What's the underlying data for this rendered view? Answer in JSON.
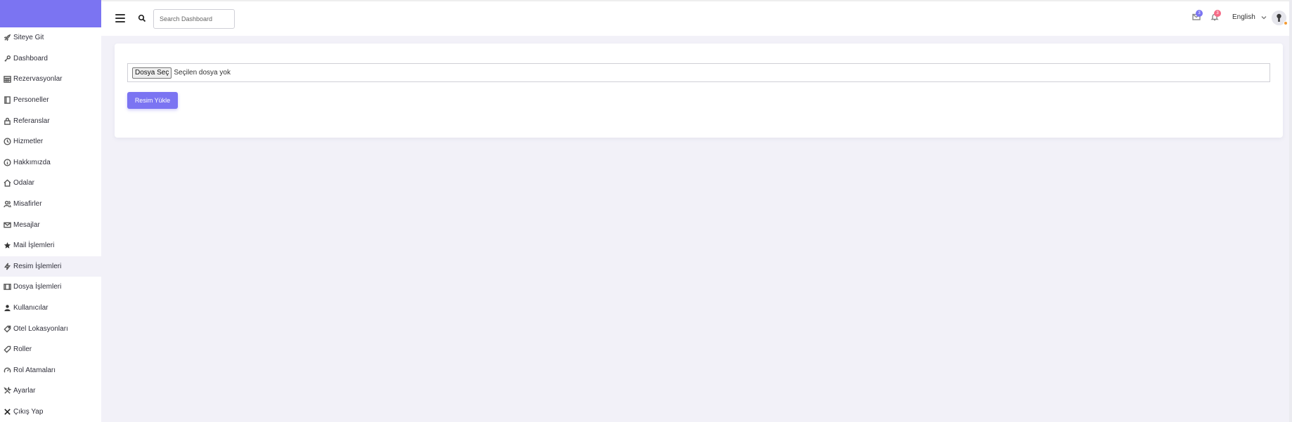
{
  "header": {
    "search_placeholder": "Search Dashboard",
    "mail_badge": "3",
    "notification_badge": "3",
    "language": "English"
  },
  "sidebar": {
    "items": [
      {
        "label": "Siteye Git",
        "icon": "rocket-icon"
      },
      {
        "label": "Dashboard",
        "icon": "key-icon"
      },
      {
        "label": "Rezervasyonlar",
        "icon": "calendar-icon"
      },
      {
        "label": "Personeller",
        "icon": "book-icon"
      },
      {
        "label": "Referanslar",
        "icon": "lock-icon"
      },
      {
        "label": "Hizmetler",
        "icon": "clock-icon"
      },
      {
        "label": "Hakkımızda",
        "icon": "info-icon"
      },
      {
        "label": "Odalar",
        "icon": "home-icon"
      },
      {
        "label": "Misafirler",
        "icon": "users-icon"
      },
      {
        "label": "Mesajlar",
        "icon": "envelope-icon"
      },
      {
        "label": "Mail İşlemleri",
        "icon": "star-icon"
      },
      {
        "label": "Resim İşlemleri",
        "icon": "bolt-icon"
      },
      {
        "label": "Dosya İşlemleri",
        "icon": "film-icon"
      },
      {
        "label": "Kullanıcılar",
        "icon": "user-icon"
      },
      {
        "label": "Otel Lokasyonları",
        "icon": "tag-icon"
      },
      {
        "label": "Roller",
        "icon": "tag-outline-icon"
      },
      {
        "label": "Rol Atamaları",
        "icon": "gauge-icon"
      },
      {
        "label": "Ayarlar",
        "icon": "tools-icon"
      },
      {
        "label": "Çıkış Yap",
        "icon": "close-icon"
      }
    ],
    "active_index": 11
  },
  "main": {
    "file_button_label": "Dosya Seç",
    "file_status": "Seçilen dosya yok",
    "upload_button_label": "Resim Yükle"
  },
  "colors": {
    "accent": "#7b74f2",
    "mail_badge": "#7b74f2",
    "notification_badge": "#f56b86",
    "background": "#f2f1f8"
  }
}
